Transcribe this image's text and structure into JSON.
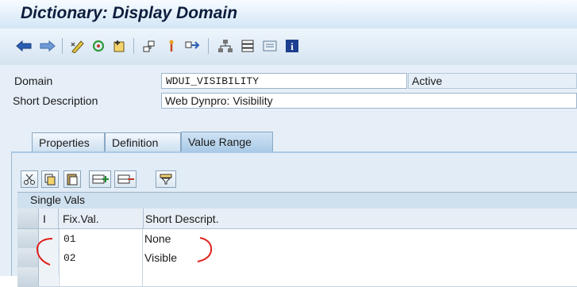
{
  "window": {
    "title": "Dictionary: Display Domain"
  },
  "toolbar": {
    "buttons": [
      {
        "icon": "back-arrow-icon"
      },
      {
        "icon": "forward-arrow-icon"
      },
      {
        "icon": "display-change-icon"
      },
      {
        "icon": "other-object-icon"
      },
      {
        "icon": "activate-icon"
      },
      {
        "icon": "where-used-icon"
      },
      {
        "icon": "test-icon"
      },
      {
        "icon": "navigate-icon"
      },
      {
        "icon": "hierarchy-icon"
      },
      {
        "icon": "stack-icon"
      },
      {
        "icon": "list-icon"
      },
      {
        "icon": "info-icon"
      }
    ]
  },
  "header": {
    "domain_label": "Domain",
    "domain_value": "WDUI_VISIBILITY",
    "status": "Active",
    "short_desc_label": "Short Description",
    "short_desc_value": "Web Dynpro: Visibility"
  },
  "tabs": [
    {
      "label": "Properties",
      "active": false
    },
    {
      "label": "Definition",
      "active": false
    },
    {
      "label": "Value Range",
      "active": true
    }
  ],
  "table": {
    "section_title": "Single Vals",
    "columns": {
      "i": "I",
      "fix_val": "Fix.Val.",
      "short_descript": "Short Descript."
    },
    "rows": [
      {
        "fix_val": "01",
        "short_descript": "None"
      },
      {
        "fix_val": "02",
        "short_descript": "Visible"
      },
      {
        "fix_val": "",
        "short_descript": ""
      }
    ]
  },
  "panel_tools": [
    "cut-icon",
    "copy-icon",
    "paste-icon",
    "insert-row-icon",
    "delete-row-icon",
    "filter-icon"
  ],
  "colors": {
    "annotation": "#e0201c",
    "title": "#0c1d3c"
  }
}
